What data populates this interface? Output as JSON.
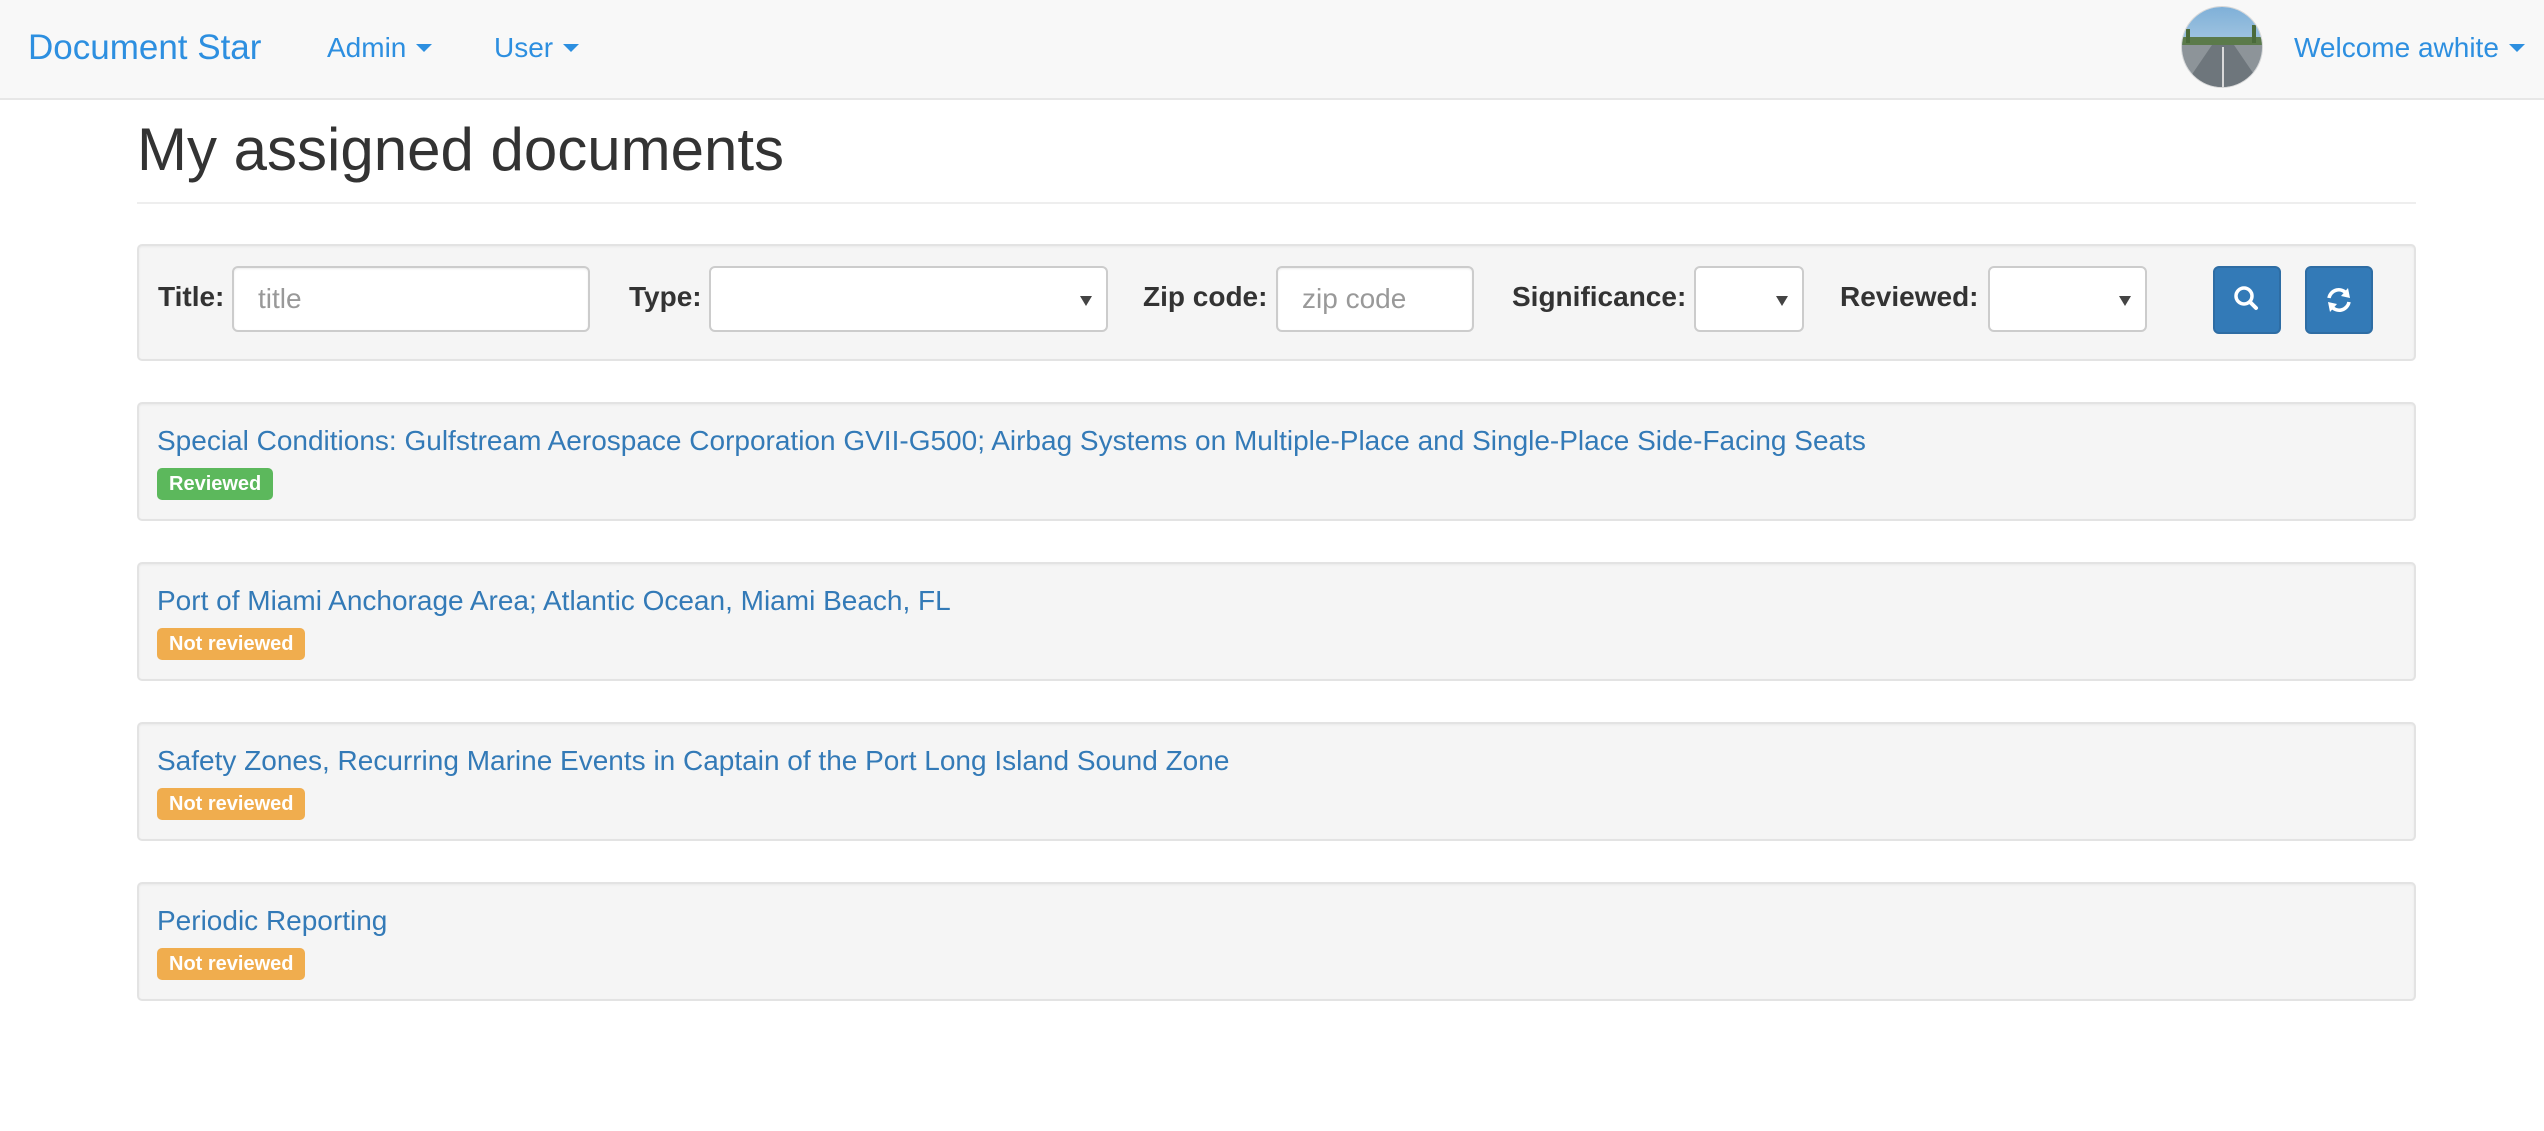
{
  "navbar": {
    "brand": "Document Star",
    "menus": [
      {
        "label": "Admin"
      },
      {
        "label": "User"
      }
    ],
    "welcome": "Welcome awhite"
  },
  "page": {
    "title": "My assigned documents"
  },
  "filters": {
    "title_label": "Title:",
    "title_placeholder": "title",
    "title_value": "",
    "type_label": "Type:",
    "type_value": "",
    "zip_label": "Zip code:",
    "zip_placeholder": "zip code",
    "zip_value": "",
    "significance_label": "Significance:",
    "significance_value": "",
    "reviewed_label": "Reviewed:",
    "reviewed_value": "",
    "search_icon": "search-icon",
    "refresh_icon": "refresh-icon"
  },
  "documents": [
    {
      "title": "Special Conditions: Gulfstream Aerospace Corporation GVII-G500; Airbag Systems on Multiple-Place and Single-Place Side-Facing Seats",
      "status": "Reviewed",
      "status_color": "#5cb85c"
    },
    {
      "title": "Port of Miami Anchorage Area; Atlantic Ocean, Miami Beach, FL",
      "status": "Not reviewed",
      "status_color": "#f0ad4e"
    },
    {
      "title": "Safety Zones, Recurring Marine Events in Captain of the Port Long Island Sound Zone",
      "status": "Not reviewed",
      "status_color": "#f0ad4e"
    },
    {
      "title": "Periodic Reporting",
      "status": "Not reviewed",
      "status_color": "#f0ad4e"
    }
  ],
  "colors": {
    "link": "#337ab7",
    "nav_link": "#2d8fe0",
    "primary_button": "#337ab7",
    "reviewed": "#5cb85c",
    "not_reviewed": "#f0ad4e"
  }
}
